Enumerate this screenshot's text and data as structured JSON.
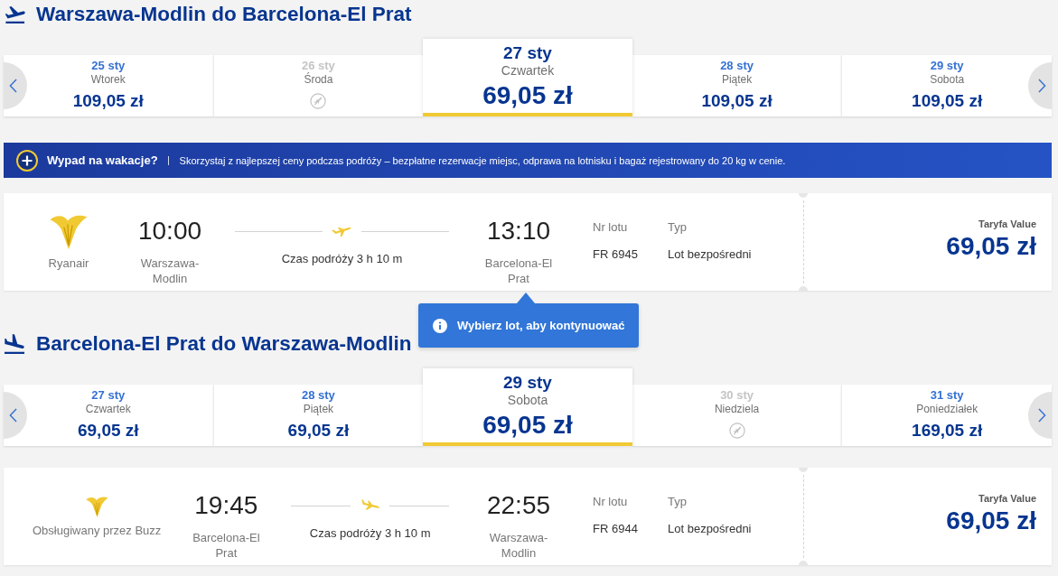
{
  "sections": [
    {
      "kind": "outbound",
      "title": "Warszawa-Modlin do Barcelona-El Prat",
      "days": [
        {
          "date": "25 sty",
          "weekday": "Wtorek",
          "price": "109,05 zł",
          "selected": false,
          "disabled": false
        },
        {
          "date": "26 sty",
          "weekday": "Środa",
          "selected": false,
          "disabled": true
        },
        {
          "date": "27 sty",
          "weekday": "Czwartek",
          "price": "69,05 zł",
          "selected": true,
          "disabled": false
        },
        {
          "date": "28 sty",
          "weekday": "Piątek",
          "price": "109,05 zł",
          "selected": false,
          "disabled": false
        },
        {
          "date": "29 sty",
          "weekday": "Sobota",
          "price": "109,05 zł",
          "selected": false,
          "disabled": false
        }
      ],
      "banner": {
        "title": "Wypad na wakacje?",
        "text": "Skorzystaj z najlepszej ceny podczas podróży – bezpłatne rezerwacje miejsc, odprawa na lotnisku i bagaż rejestrowany do 20 kg w cenie."
      },
      "flight": {
        "carrier": {
          "kind": "own",
          "name": "Ryanair"
        },
        "departure": {
          "time": "10:00",
          "airport": "Warszawa-Modlin"
        },
        "duration": "Czas podróży 3 h 10 m",
        "arrival": {
          "time": "13:10",
          "airport": "Barcelona-El Prat"
        },
        "flight_number": {
          "label": "Nr lotu",
          "value": "FR 6945"
        },
        "type": {
          "label": "Typ",
          "value": "Lot bezpośredni"
        },
        "fare": {
          "label": "Taryfa Value",
          "price": "69,05 zł"
        },
        "tooltip": {
          "text": "Wybierz lot, aby kontynuować"
        }
      }
    },
    {
      "kind": "inbound",
      "title": "Barcelona-El Prat do Warszawa-Modlin",
      "days": [
        {
          "date": "27 sty",
          "weekday": "Czwartek",
          "price": "69,05 zł",
          "selected": false,
          "disabled": false
        },
        {
          "date": "28 sty",
          "weekday": "Piątek",
          "price": "69,05 zł",
          "selected": false,
          "disabled": false
        },
        {
          "date": "29 sty",
          "weekday": "Sobota",
          "price": "69,05 zł",
          "selected": true,
          "disabled": false
        },
        {
          "date": "30 sty",
          "weekday": "Niedziela",
          "selected": false,
          "disabled": true
        },
        {
          "date": "31 sty",
          "weekday": "Poniedziałek",
          "price": "169,05 zł",
          "selected": false,
          "disabled": false
        }
      ],
      "flight": {
        "carrier": {
          "kind": "operated",
          "name": "Obsługiwany przez Buzz"
        },
        "departure": {
          "time": "19:45",
          "airport": "Barcelona-El Prat"
        },
        "duration": "Czas podróży 3 h 10 m",
        "arrival": {
          "time": "22:55",
          "airport": "Warszawa-Modlin"
        },
        "flight_number": {
          "label": "Nr lotu",
          "value": "FR 6944"
        },
        "type": {
          "label": "Typ",
          "value": "Lot bezpośredni"
        },
        "fare": {
          "label": "Taryfa Value",
          "price": "69,05 zł"
        }
      }
    }
  ]
}
